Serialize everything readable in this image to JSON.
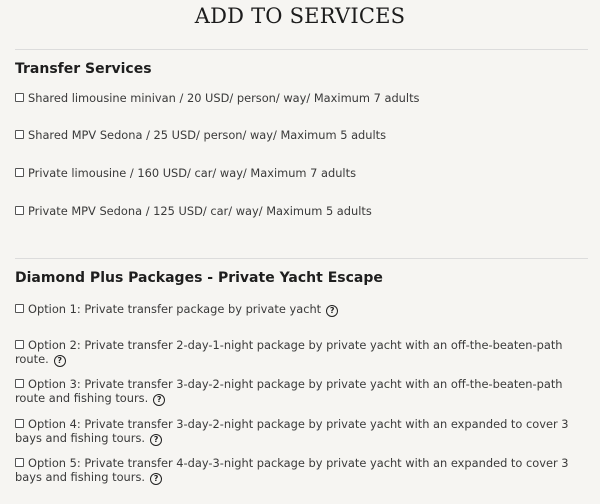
{
  "page": {
    "title": "ADD TO SERVICES"
  },
  "transfer": {
    "heading": "Transfer Services",
    "options": [
      "Shared limousine minivan / 20 USD/ person/ way/ Maximum 7 adults",
      "Shared MPV Sedona / 25 USD/ person/ way/ Maximum 5 adults",
      "Private limousine / 160 USD/ car/ way/ Maximum 7 adults",
      "Private MPV Sedona / 125 USD/ car/ way/ Maximum 5 adults"
    ]
  },
  "packages": {
    "heading": "Diamond Plus Packages - Private Yacht Escape",
    "options": [
      "Option 1: Private transfer package by private yacht",
      "Option 2: Private transfer 2-day-1-night package by private yacht with an off-the-beaten-path route.",
      "Option 3: Private transfer 3-day-2-night package by private yacht with an off-the-beaten-path route and fishing tours.",
      "Option 4: Private transfer 3-day-2-night package by private yacht with an expanded to cover 3 bays and fishing tours.",
      "Option 5: Private transfer 4-day-3-night package by private yacht with an expanded to cover 3 bays and fishing tours."
    ],
    "help_glyph": "?"
  }
}
